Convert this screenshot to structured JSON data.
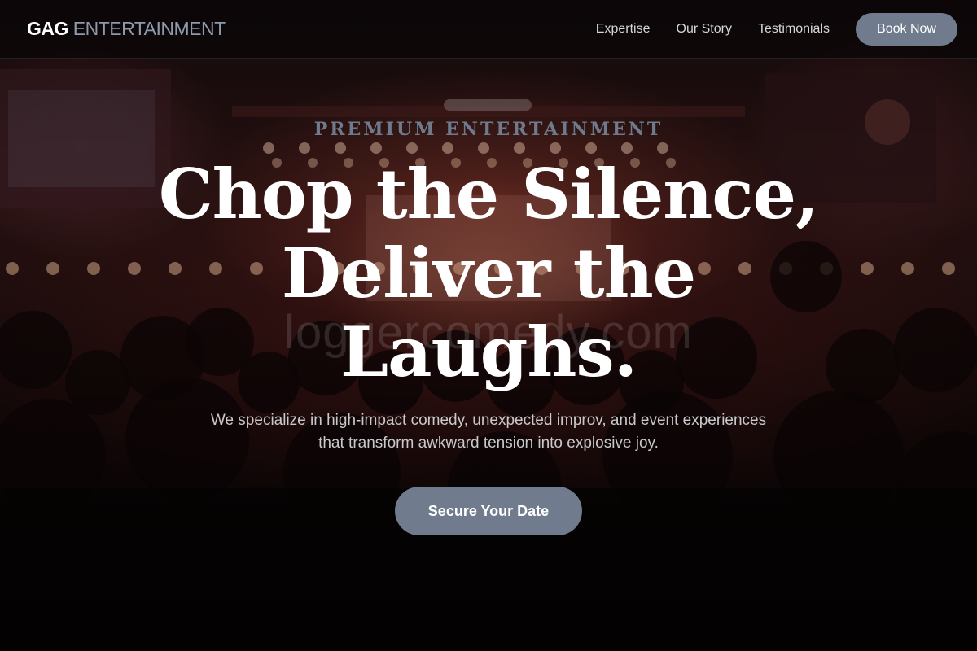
{
  "colors": {
    "accent": "#707c8e",
    "logo_light": "#8f9aab",
    "eyebrow": "#6f7a8c",
    "header_bg": "#0a0607",
    "text_white": "#ffffff",
    "text_muted": "#c9c9cc"
  },
  "header": {
    "logo": {
      "strong": "GAG",
      "light": "ENTERTAINMENT"
    },
    "nav": {
      "items": [
        {
          "label": "Expertise"
        },
        {
          "label": "Our Story"
        },
        {
          "label": "Testimonials"
        }
      ],
      "cta_label": "Book Now"
    }
  },
  "hero": {
    "eyebrow": "PREMIUM ENTERTAINMENT",
    "headline_lines": [
      "Chop the Silence,",
      "Deliver the",
      "Laughs."
    ],
    "subtext": "We specialize in high-impact comedy, unexpected improv, and event experiences that transform awkward tension into explosive joy.",
    "cta_label": "Secure Your Date",
    "watermark": "loggercomedy.com"
  },
  "background": {
    "description_icon": "concert-crowd-photo"
  }
}
